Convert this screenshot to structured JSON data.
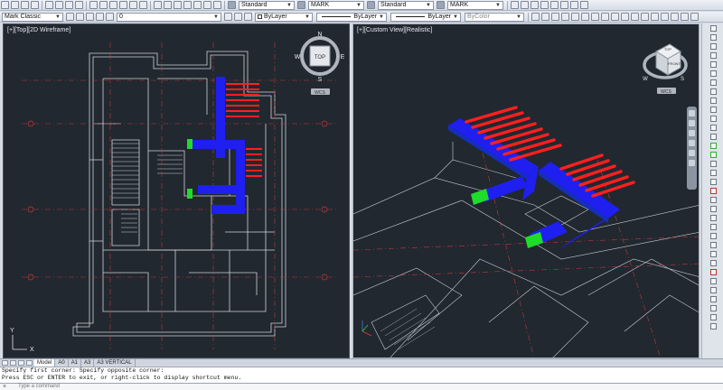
{
  "toolbar": {
    "workspace": "Mark Classic",
    "layer": "0",
    "text_style": "Standard",
    "dim_style": "MARK",
    "table_style": "Standard",
    "mleader_style": "MARK",
    "color": "ByLayer",
    "linetype": "ByLayer",
    "lineweight": "ByLayer",
    "plotstyle": "ByColor"
  },
  "viewports": {
    "left_label": "[+][Top][2D Wireframe]",
    "right_label": "[+][Custom View][Realistic]",
    "compass": {
      "center": "TOP",
      "n": "N",
      "s": "S",
      "e": "E",
      "w": "W",
      "wcs": "WCS"
    },
    "cube": {
      "face": "FRONT",
      "top": "TOP",
      "wcs": "WCS"
    },
    "ucs_left": {
      "x": "X",
      "y": "Y"
    }
  },
  "tabs": [
    {
      "label": "Model"
    },
    {
      "label": "A0"
    },
    {
      "label": "A1"
    },
    {
      "label": "A3"
    },
    {
      "label": "A3 VERTICAL"
    }
  ],
  "command": {
    "history": [
      "Specify first corner: Specify opposite corner:",
      "Press ESC or ENTER to exit, or right-click to display shortcut menu."
    ],
    "placeholder": "Type a command"
  },
  "colors": {
    "viewport_bg": "#212830",
    "duct_blue": "#1f1ff0",
    "grille_red": "#ff1f1f",
    "damper_green": "#1fdc2a"
  }
}
